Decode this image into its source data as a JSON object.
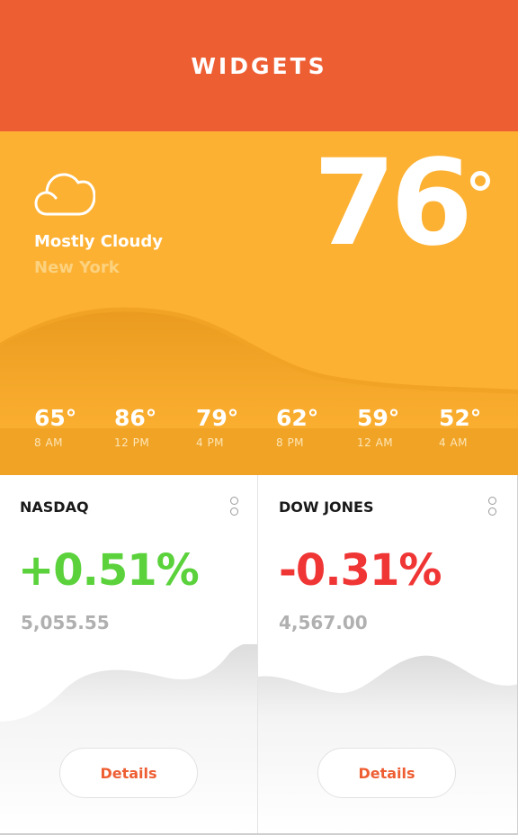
{
  "header": {
    "title": "WIDGETS"
  },
  "colors": {
    "header_bg": "#ee5e33",
    "weather_bg": "#fdb133",
    "positive": "#5bd23c",
    "negative": "#f03535",
    "accent": "#ee5e33"
  },
  "weather": {
    "icon": "cloud-icon",
    "condition": "Mostly Cloudy",
    "location": "New York",
    "temperature": "76",
    "forecast": [
      {
        "temp": "65°",
        "time": "8 AM"
      },
      {
        "temp": "86°",
        "time": "12 PM"
      },
      {
        "temp": "79°",
        "time": "4 PM"
      },
      {
        "temp": "62°",
        "time": "8 PM"
      },
      {
        "temp": "59°",
        "time": "12 AM"
      },
      {
        "temp": "52°",
        "time": "4 AM"
      }
    ]
  },
  "stocks": [
    {
      "name": "NASDAQ",
      "change": "+0.51%",
      "value": "5,055.55",
      "details_label": "Details",
      "menu_icon": "more-vertical-icon"
    },
    {
      "name": "DOW JONES",
      "change": "-0.31%",
      "value": "4,567.00",
      "details_label": "Details",
      "menu_icon": "more-vertical-icon"
    }
  ]
}
